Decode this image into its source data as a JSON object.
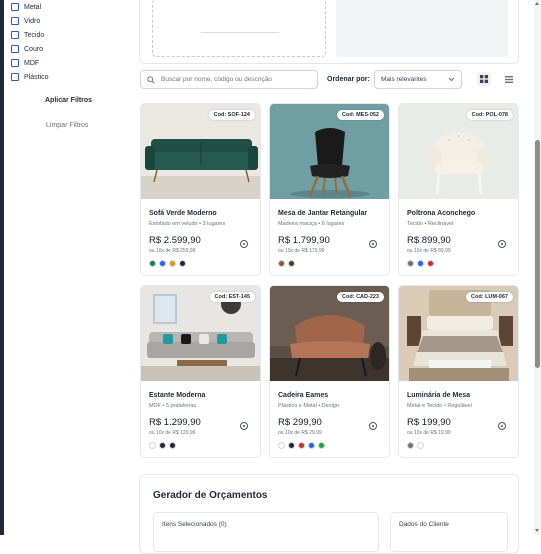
{
  "sidebar": {
    "materials": [
      "Metal",
      "Vidro",
      "Tecido",
      "Couro",
      "MDF",
      "Plástico"
    ],
    "apply_label": "Aplicar Filtros",
    "clear_label": "Limpar Filtros"
  },
  "toolbar": {
    "search_placeholder": "Buscar por nome, código ou descrição",
    "order_label": "Ordenar por:",
    "order_value": "Mais relevantes"
  },
  "products": [
    {
      "code": "Cod: SOF-124",
      "name": "Sofá Verde Moderno",
      "desc": "Estofado em veludo • 3 lugares",
      "price": "R$ 2.599,90",
      "installments": "ou 10x de R$ 259,99",
      "swatches": [
        "#1e7a46",
        "#2563eb",
        "#d4a017",
        "#1f2937"
      ],
      "image": "sofa"
    },
    {
      "code": "Cod: MES-052",
      "name": "Mesa de Jantar Retangular",
      "desc": "Madeira maciça • 6 lugares",
      "price": "R$ 1.799,90",
      "installments": "ou 10x de R$ 179,99",
      "swatches": [
        "#8b5a2b",
        "#5a3a1e"
      ],
      "image": "chair"
    },
    {
      "code": "Cod: POL-078",
      "name": "Poltrona Aconchego",
      "desc": "Tecido • Reclinável",
      "price": "R$ 899,90",
      "installments": "ou 10x de R$ 89,99",
      "swatches": [
        "#6b7280",
        "#2563eb",
        "#dc2626"
      ],
      "image": "armchair"
    },
    {
      "code": "Cod: EST-145",
      "name": "Estante Moderna",
      "desc": "MDF • 5 prateleiras",
      "price": "R$ 1.299,90",
      "installments": "ou 10x de R$ 129,99",
      "swatches": [
        "#ffffff",
        "#1f2937",
        "#1f2937"
      ],
      "image": "livingroom"
    },
    {
      "code": "Cod: CAD-223",
      "name": "Cadeira Eames",
      "desc": "Plástico e Metal • Design",
      "price": "R$ 299,90",
      "installments": "ou 10x de R$ 29,99",
      "swatches": [
        "#ffffff",
        "#1f2937",
        "#dc2626",
        "#2563eb",
        "#16a34a"
      ],
      "image": "loungechair"
    },
    {
      "code": "Cod: LUM-067",
      "name": "Luminária de Mesa",
      "desc": "Metal e Tecido • Regulável",
      "price": "R$ 199,90",
      "installments": "ou 10x de R$ 19,99",
      "swatches": [
        "#6b7280",
        "#ffffff"
      ],
      "image": "bedroom"
    }
  ],
  "quote": {
    "title": "Gerador de Orçamentos",
    "items_label": "Itens Selecionados (0)",
    "client_label": "Dados do Cliente"
  }
}
